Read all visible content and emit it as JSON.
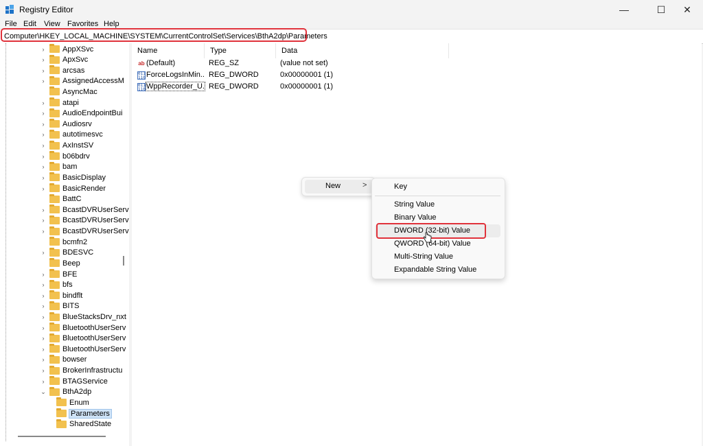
{
  "window": {
    "title": "Registry Editor",
    "controls": {
      "minimize": "—",
      "maximize": "☐",
      "close": "✕"
    }
  },
  "menubar": {
    "items": [
      "File",
      "Edit",
      "View",
      "Favorites",
      "Help"
    ]
  },
  "address": {
    "path": "Computer\\HKEY_LOCAL_MACHINE\\SYSTEM\\CurrentControlSet\\Services\\BthA2dp\\Parameters"
  },
  "tree": {
    "items": [
      {
        "label": "AppXSvc",
        "expandable": true
      },
      {
        "label": "ApxSvc",
        "expandable": true
      },
      {
        "label": "arcsas",
        "expandable": true
      },
      {
        "label": "AssignedAccessM",
        "expandable": true
      },
      {
        "label": "AsyncMac",
        "expandable": false
      },
      {
        "label": "atapi",
        "expandable": true
      },
      {
        "label": "AudioEndpointBui",
        "expandable": true
      },
      {
        "label": "Audiosrv",
        "expandable": true
      },
      {
        "label": "autotimesvc",
        "expandable": true
      },
      {
        "label": "AxInstSV",
        "expandable": true
      },
      {
        "label": "b06bdrv",
        "expandable": true
      },
      {
        "label": "bam",
        "expandable": true
      },
      {
        "label": "BasicDisplay",
        "expandable": true
      },
      {
        "label": "BasicRender",
        "expandable": true
      },
      {
        "label": "BattC",
        "expandable": false
      },
      {
        "label": "BcastDVRUserServ",
        "expandable": true
      },
      {
        "label": "BcastDVRUserServ",
        "expandable": true
      },
      {
        "label": "BcastDVRUserServ",
        "expandable": true
      },
      {
        "label": "bcmfn2",
        "expandable": false
      },
      {
        "label": "BDESVC",
        "expandable": true
      },
      {
        "label": "Beep",
        "expandable": false
      },
      {
        "label": "BFE",
        "expandable": true
      },
      {
        "label": "bfs",
        "expandable": true
      },
      {
        "label": "bindflt",
        "expandable": true
      },
      {
        "label": "BITS",
        "expandable": true
      },
      {
        "label": "BlueStacksDrv_nxt",
        "expandable": true
      },
      {
        "label": "BluetoothUserServ",
        "expandable": true
      },
      {
        "label": "BluetoothUserServ",
        "expandable": true
      },
      {
        "label": "BluetoothUserServ",
        "expandable": true
      },
      {
        "label": "bowser",
        "expandable": true
      },
      {
        "label": "BrokerInfrastructu",
        "expandable": true
      },
      {
        "label": "BTAGService",
        "expandable": true
      },
      {
        "label": "BthA2dp",
        "expandable": true,
        "expanded": true
      },
      {
        "label": "Enum",
        "expandable": false,
        "child": true
      },
      {
        "label": "Parameters",
        "expandable": false,
        "child": true,
        "selected": true
      },
      {
        "label": "SharedState",
        "expandable": false,
        "child": true
      }
    ]
  },
  "values": {
    "headers": {
      "name": "Name",
      "type": "Type",
      "data": "Data"
    },
    "rows": [
      {
        "icon": "string-value-icon",
        "name": "(Default)",
        "type": "REG_SZ",
        "data": "(value not set)"
      },
      {
        "icon": "binary-value-icon",
        "name": "ForceLogsInMin...",
        "type": "REG_DWORD",
        "data": "0x00000001 (1)"
      },
      {
        "icon": "binary-value-icon",
        "name": "WppRecorder_U...",
        "type": "REG_DWORD",
        "data": "0x00000001 (1)"
      }
    ]
  },
  "context_menu": {
    "new_label": "New",
    "new_arrow": ">",
    "submenu": [
      "Key",
      "String Value",
      "Binary Value",
      "DWORD (32-bit) Value",
      "QWORD (64-bit) Value",
      "Multi-String Value",
      "Expandable String Value"
    ]
  },
  "colors": {
    "highlight": "#e0313a",
    "folder": "#f2c14e",
    "selection": "#cfe3f7"
  }
}
